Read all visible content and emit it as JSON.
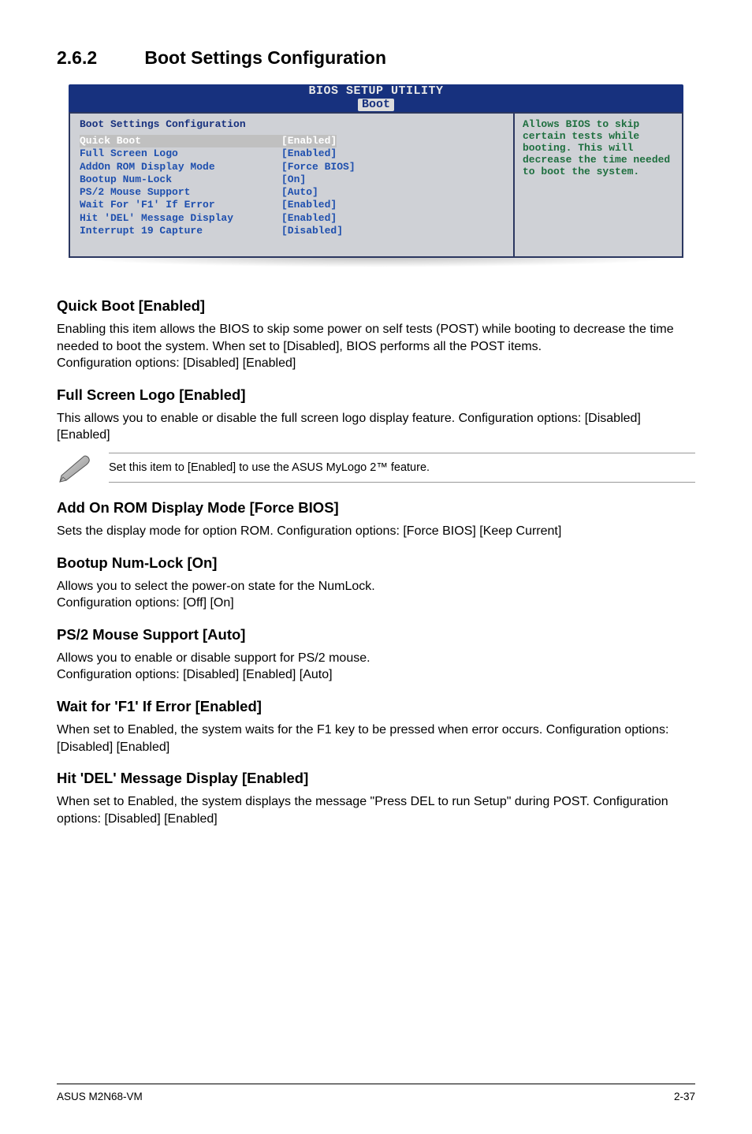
{
  "header": {
    "number": "2.6.2",
    "title": "Boot Settings Configuration"
  },
  "bios": {
    "utility_title": "BIOS SETUP UTILITY",
    "tab": "Boot",
    "panel_title": "Boot Settings Configuration",
    "rows": [
      {
        "label": "Quick Boot",
        "value": "[Enabled]",
        "selected": true
      },
      {
        "label": "Full Screen Logo",
        "value": "[Enabled]"
      },
      {
        "label": "AddOn ROM Display Mode",
        "value": "[Force BIOS]"
      },
      {
        "label": "Bootup Num-Lock",
        "value": "[On]"
      },
      {
        "label": "PS/2 Mouse Support",
        "value": "[Auto]"
      },
      {
        "label": "Wait For 'F1' If Error",
        "value": "[Enabled]"
      },
      {
        "label": "Hit 'DEL' Message Display",
        "value": "[Enabled]"
      },
      {
        "label": "Interrupt 19 Capture",
        "value": "[Disabled]"
      }
    ],
    "help": "Allows BIOS to skip certain tests while booting. This will decrease the time needed to boot the system."
  },
  "sections": {
    "quick_boot": {
      "title": "Quick Boot [Enabled]",
      "body": "Enabling this item allows the BIOS to skip some power on self tests (POST) while booting to decrease the time needed to boot the system. When set to [Disabled], BIOS performs all the POST items.\nConfiguration options: [Disabled] [Enabled]"
    },
    "full_screen": {
      "title": "Full Screen Logo [Enabled]",
      "body": "This allows you to enable or disable the full screen logo display feature. Configuration options: [Disabled] [Enabled]"
    },
    "note": "Set this item to [Enabled] to use the ASUS MyLogo 2™ feature.",
    "add_on_rom": {
      "title": "Add On ROM Display Mode [Force BIOS]",
      "body": "Sets the display mode for option ROM. Configuration options: [Force BIOS] [Keep Current]"
    },
    "bootup": {
      "title": "Bootup Num-Lock [On]",
      "body": "Allows you to select the power-on state for the NumLock.\nConfiguration options: [Off] [On]"
    },
    "ps2": {
      "title": "PS/2 Mouse Support [Auto]",
      "body": "Allows you to enable or disable support for PS/2 mouse.\nConfiguration options: [Disabled] [Enabled] [Auto]"
    },
    "waitf1": {
      "title": "Wait for 'F1' If Error [Enabled]",
      "body": "When set to Enabled, the system waits for the F1 key to be pressed when error occurs. Configuration options: [Disabled] [Enabled]"
    },
    "hitdel": {
      "title": "Hit 'DEL' Message Display [Enabled]",
      "body": "When set to Enabled, the system displays the message \"Press DEL to run Setup\" during POST. Configuration options: [Disabled] [Enabled]"
    }
  },
  "footer": {
    "left": "ASUS M2N68-VM",
    "right": "2-37"
  }
}
